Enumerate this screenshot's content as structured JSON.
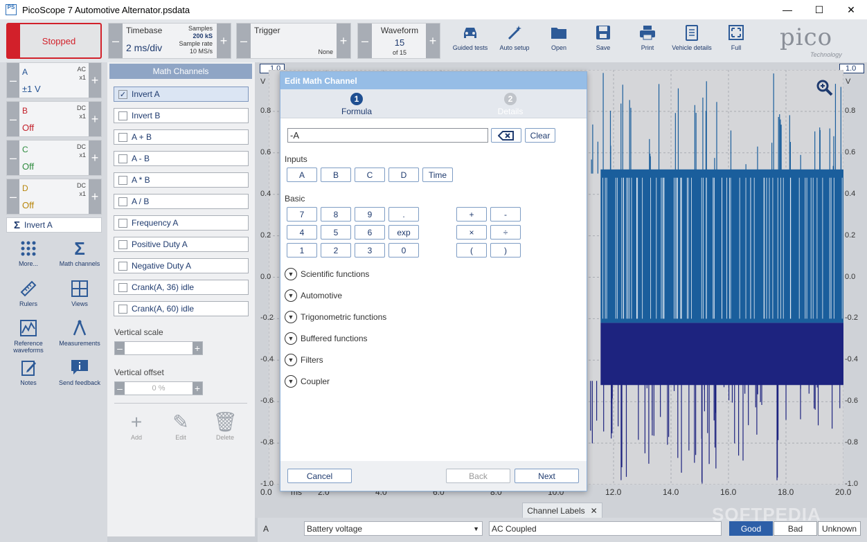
{
  "window": {
    "title": "PicoScope 7 Automotive Alternator.psdata",
    "app_icon": "PS"
  },
  "toolbar": {
    "run_state": "Stopped",
    "timebase": {
      "label": "Timebase",
      "value": "2 ms/div",
      "samples_label": "Samples",
      "samples_value": "200 kS",
      "rate_label": "Sample rate",
      "rate_value": "10 MS/s"
    },
    "trigger": {
      "label": "Trigger",
      "value": "None"
    },
    "waveform": {
      "label": "Waveform",
      "current": "15",
      "of": "of 15"
    },
    "buttons": [
      "Guided tests",
      "Auto setup",
      "Open",
      "Save",
      "Print",
      "Vehicle details",
      "Full"
    ],
    "logo": "pico",
    "logo_sub": "Technology"
  },
  "channels": [
    {
      "name": "A",
      "coupling": "AC",
      "probe": "x1",
      "value": "±1 V",
      "color": "#1f4f91"
    },
    {
      "name": "B",
      "coupling": "DC",
      "probe": "x1",
      "value": "Off",
      "color": "#c3202a"
    },
    {
      "name": "C",
      "coupling": "DC",
      "probe": "x1",
      "value": "Off",
      "color": "#2e8b3e"
    },
    {
      "name": "D",
      "coupling": "DC",
      "probe": "x1",
      "value": "Off",
      "color": "#b8860b"
    }
  ],
  "math_pill": "Invert A",
  "left_tools": [
    "More...",
    "Math channels",
    "Rulers",
    "Views",
    "Reference waveforms",
    "Measurements",
    "Notes",
    "Send feedback"
  ],
  "math_panel": {
    "title": "Math Channels",
    "items": [
      {
        "label": "Invert A",
        "checked": true
      },
      {
        "label": "Invert B",
        "checked": false
      },
      {
        "label": "A + B",
        "checked": false
      },
      {
        "label": "A - B",
        "checked": false
      },
      {
        "label": "A * B",
        "checked": false
      },
      {
        "label": "A / B",
        "checked": false
      },
      {
        "label": "Frequency A",
        "checked": false
      },
      {
        "label": "Positive Duty A",
        "checked": false
      },
      {
        "label": "Negative Duty A",
        "checked": false
      },
      {
        "label": "Crank(A, 36) idle",
        "checked": false
      },
      {
        "label": "Crank(A, 60) idle",
        "checked": false
      }
    ],
    "vertical_scale_label": "Vertical scale",
    "vertical_offset_label": "Vertical offset",
    "vertical_offset_value": "0 %",
    "actions": [
      "Add",
      "Edit",
      "Delete"
    ]
  },
  "scope": {
    "left_marker": "1.0",
    "right_marker": "1.0",
    "unit": "V",
    "y_ticks": [
      "0.8",
      "0.6",
      "0.4",
      "0.2",
      "0.0",
      "-0.2",
      "-0.4",
      "-0.6",
      "-0.8",
      "-1.0"
    ],
    "x_ticks": [
      "0.0",
      "2.0",
      "4.0",
      "6.0",
      "8.0",
      "10.0",
      "12.0",
      "14.0",
      "16.0",
      "18.0",
      "20.0"
    ],
    "x_unit": "ms",
    "x_range": [
      0,
      20
    ],
    "y_range": [
      -1,
      1
    ],
    "wave_colors": [
      "#1a5e9c",
      "#1d237f"
    ]
  },
  "channel_labels_tab": "Channel Labels",
  "bottom": {
    "channel": "A",
    "label_value": "Battery voltage",
    "description": "AC Coupled",
    "ratings": [
      "Good",
      "Bad",
      "Unknown"
    ],
    "selected_rating": "Good"
  },
  "dialog": {
    "title": "Edit Math Channel",
    "steps": [
      {
        "num": "1",
        "label": "Formula",
        "active": true
      },
      {
        "num": "2",
        "label": "Details",
        "active": false
      }
    ],
    "formula": "-A",
    "clear_label": "Clear",
    "inputs_label": "Inputs",
    "inputs": [
      "A",
      "B",
      "C",
      "D",
      "Time"
    ],
    "basic_label": "Basic",
    "keypad": [
      "7",
      "8",
      "9",
      ".",
      "4",
      "5",
      "6",
      "exp",
      "1",
      "2",
      "3",
      "0"
    ],
    "operators": [
      "+",
      "-",
      "×",
      "÷",
      "(",
      ")"
    ],
    "sections": [
      "Scientific functions",
      "Automotive",
      "Trigonometric functions",
      "Buffered functions",
      "Filters",
      "Coupler"
    ],
    "cancel": "Cancel",
    "back": "Back",
    "next": "Next"
  },
  "watermark": "SOFTPEDIA"
}
